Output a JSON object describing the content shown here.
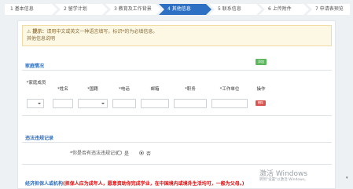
{
  "steps": [
    {
      "num": "1",
      "label": "基本信息",
      "active": false
    },
    {
      "num": "2",
      "label": "留学计划",
      "active": false
    },
    {
      "num": "3",
      "label": "教育及工作背景",
      "active": false
    },
    {
      "num": "4",
      "label": "其他信息",
      "active": true
    },
    {
      "num": "5",
      "label": "联系信息",
      "active": false
    },
    {
      "num": "6",
      "label": "上传附件",
      "active": false
    },
    {
      "num": "7",
      "label": "申请表预览",
      "active": false
    }
  ],
  "tip": {
    "icon": "warning-icon",
    "prefix": "提示：",
    "line1": "请用中文或英文一种语言填写，标识*的为必填信息。",
    "line2": "其他信息说明"
  },
  "family": {
    "title": "家庭情况",
    "add_label": "添加",
    "columns": [
      "*家庭成员",
      "*姓名",
      "*国籍",
      "*电话",
      "邮箱",
      "*职务",
      "*工作单位",
      "操作"
    ],
    "delete_label": "删除"
  },
  "violation": {
    "title": "违法违规记录",
    "question": "*你是否有违法违规记录?",
    "options": [
      "是",
      "否"
    ],
    "selected": "否"
  },
  "guarantor": {
    "title": "经济担保人或机构",
    "note": "(担保人应为成年人，愿意资助你完成学业，在中国境内或境外生活均可，一般为父母。)"
  },
  "watermark": {
    "line1": "激活 Windows",
    "line2": "转到\"设置\"以激活 Windows。"
  },
  "colors": {
    "accent": "#2d70c3",
    "required": "#d9534f",
    "add": "#5cb85c"
  }
}
